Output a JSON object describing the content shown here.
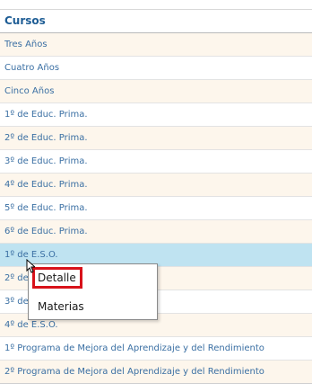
{
  "table": {
    "header": "Cursos",
    "rows": [
      "Tres Años",
      "Cuatro Años",
      "Cinco Años",
      "1º de Educ. Prima.",
      "2º de Educ. Prima.",
      "3º de Educ. Prima.",
      "4º de Educ. Prima.",
      "5º de Educ. Prima.",
      "6º de Educ. Prima.",
      "1º de E.S.O.",
      "2º de E.S.O.",
      "3º de E.S.O.",
      "4º de E.S.O.",
      "1º Programa de Mejora del Aprendizaje y del Rendimiento",
      "2º Programa de Mejora del Aprendizaje y del Rendimiento"
    ],
    "selected_row": "1º de E.S.O."
  },
  "context_menu": {
    "items": [
      "Detalle",
      "Materias"
    ]
  },
  "colors": {
    "header_text": "#1e5d95",
    "row_text": "#3a6fa3",
    "row_alt_bg": "#fdf6ec",
    "selected_bg": "#bfe3f1",
    "highlight_border": "#d8121a"
  },
  "icons": [
    "mouse-pointer-icon"
  ]
}
